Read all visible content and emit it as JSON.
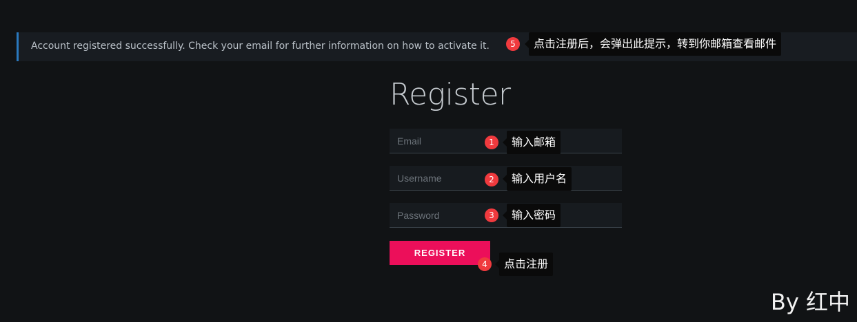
{
  "alert": {
    "message": "Account registered successfully. Check your email for further information on how to activate it.",
    "accent_color": "#2a79bf"
  },
  "form": {
    "title": "Register",
    "email_placeholder": "Email",
    "username_placeholder": "Username",
    "password_placeholder": "Password",
    "submit_label": "REGISTER",
    "submit_color": "#ec0f5a"
  },
  "annotations": [
    {
      "number": "1",
      "text": "输入邮箱"
    },
    {
      "number": "2",
      "text": "输入用户名"
    },
    {
      "number": "3",
      "text": "输入密码"
    },
    {
      "number": "4",
      "text": "点击注册"
    },
    {
      "number": "5",
      "text": "点击注册后，会弹出此提示，转到你邮箱查看邮件"
    }
  ],
  "signature": "By 红中"
}
